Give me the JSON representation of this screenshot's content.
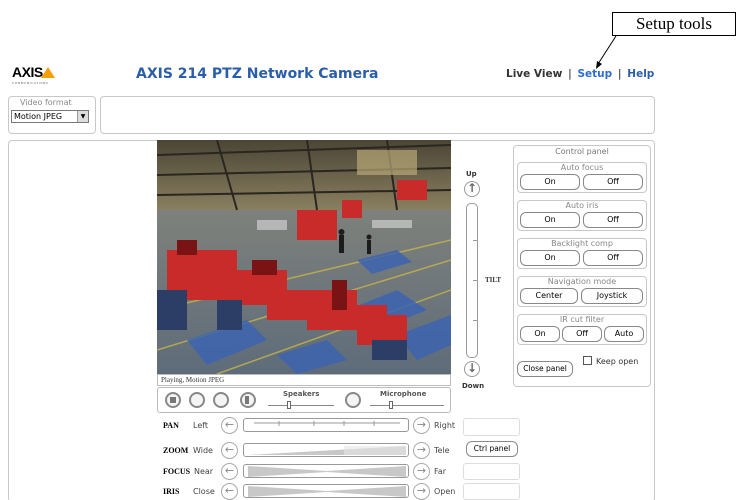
{
  "callout": {
    "label": "Setup tools"
  },
  "header": {
    "logo": "AXIS",
    "logo_sub": "COMMUNICATIONS",
    "title": "AXIS 214 PTZ Network Camera",
    "nav": {
      "live_view": "Live View",
      "separator": "|",
      "setup": "Setup",
      "help": "Help"
    }
  },
  "video_format": {
    "label": "Video format",
    "selected": "Motion JPEG"
  },
  "video": {
    "status": "Playing, Motion JPEG"
  },
  "audio": {
    "speakers": "Speakers",
    "microphone": "Microphone"
  },
  "tilt": {
    "up": "Up",
    "down": "Down",
    "label": "TILT"
  },
  "control_panel": {
    "title": "Control panel",
    "auto_focus": {
      "title": "Auto focus",
      "on": "On",
      "off": "Off"
    },
    "auto_iris": {
      "title": "Auto iris",
      "on": "On",
      "off": "Off"
    },
    "backlight": {
      "title": "Backlight comp",
      "on": "On",
      "off": "Off"
    },
    "navigation": {
      "title": "Navigation mode",
      "center": "Center",
      "joystick": "Joystick"
    },
    "ir_cut": {
      "title": "IR cut filter",
      "on": "On",
      "off": "Off",
      "auto": "Auto"
    },
    "close_panel": "Close panel",
    "keep_open": "Keep open"
  },
  "ptz": {
    "pan": {
      "label": "PAN",
      "left": "Left",
      "right": "Right"
    },
    "zoom": {
      "label": "ZOOM",
      "left": "Wide",
      "right": "Tele"
    },
    "focus": {
      "label": "FOCUS",
      "left": "Near",
      "right": "Far"
    },
    "iris": {
      "label": "IRIS",
      "left": "Close",
      "right": "Open"
    },
    "ctrl_panel": "Ctrl panel"
  },
  "colors": {
    "title_blue": "#2b5ea9",
    "setup_link": "#2e6cd1",
    "logo_accent": "#f5a000"
  }
}
